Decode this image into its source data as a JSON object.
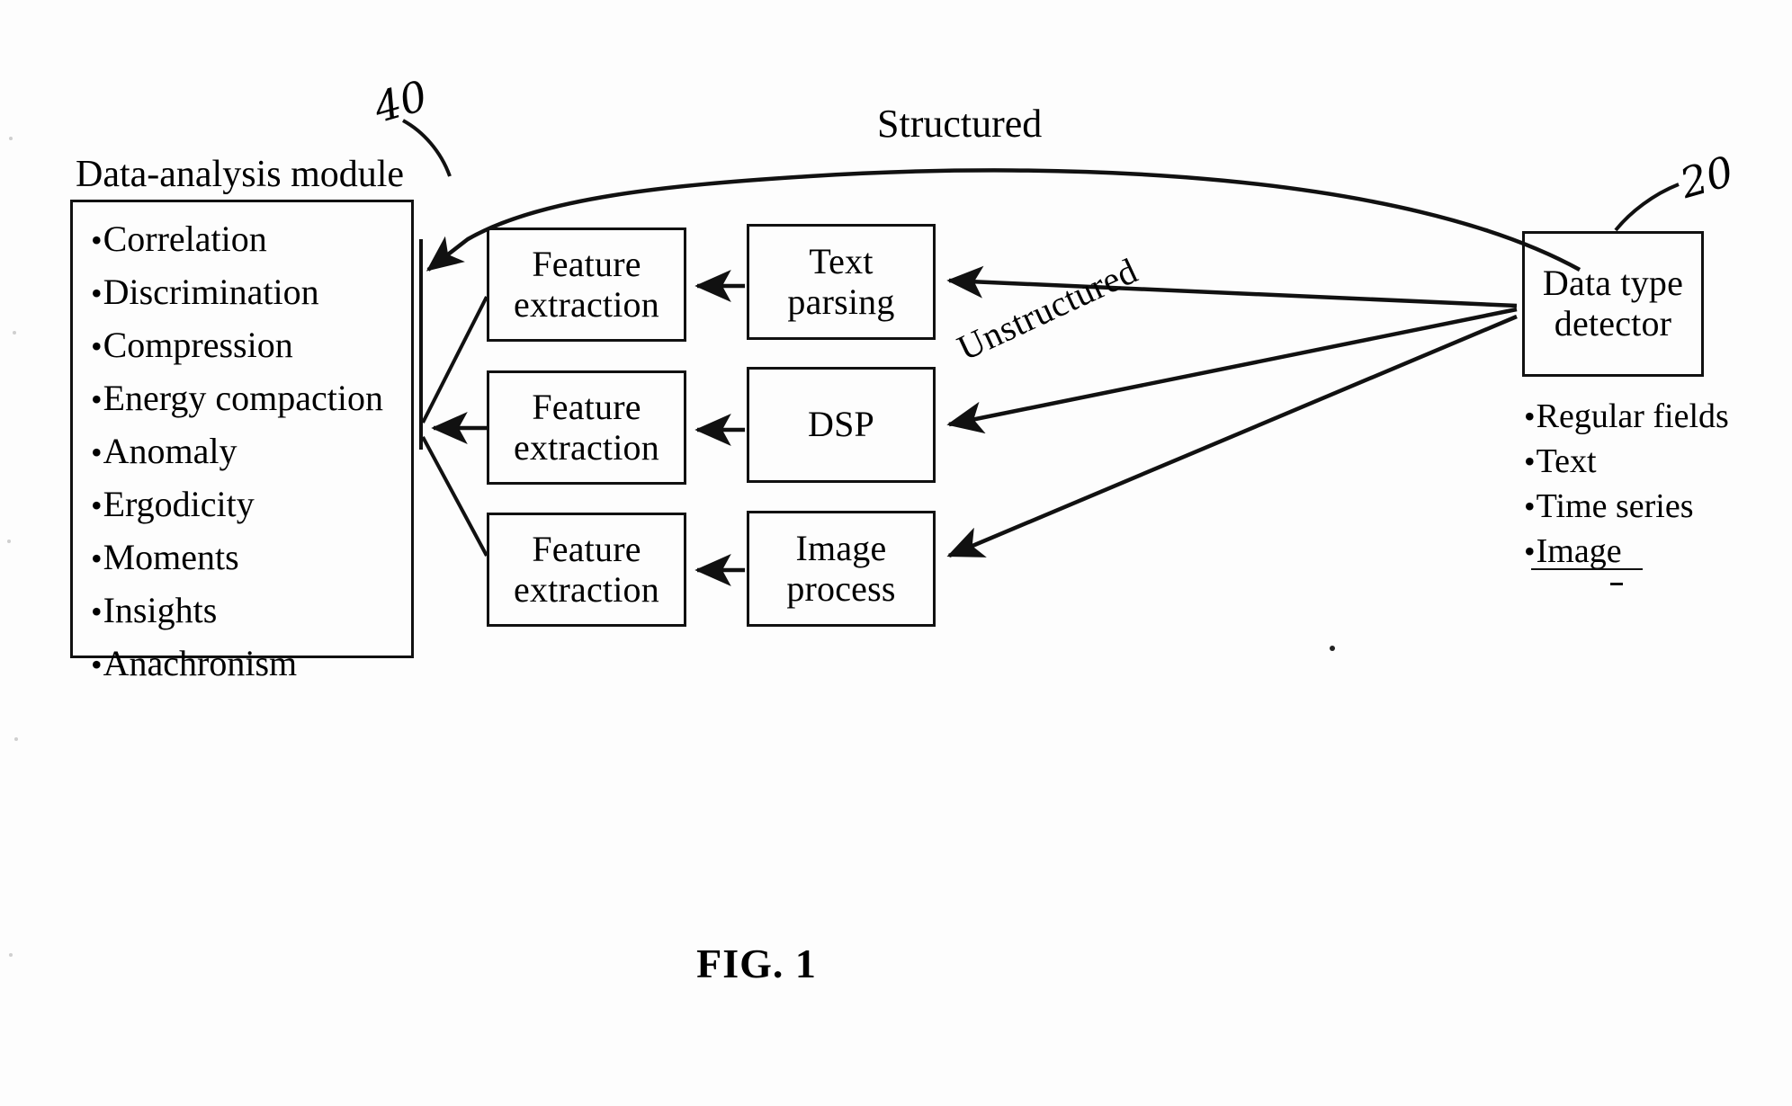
{
  "figure": {
    "caption": "FIG. 1",
    "reference_numerals": [
      {
        "id": "40",
        "target": "Data-analysis module"
      },
      {
        "id": "20",
        "target": "Data type detector"
      }
    ]
  },
  "data_analysis_module": {
    "title": "Data-analysis module",
    "ref": "40",
    "items": [
      "Correlation",
      "Discrimination",
      "Compression",
      "Energy compaction",
      "Anomaly",
      "Ergodicity",
      "Moments",
      "Insights",
      "Anachronism"
    ]
  },
  "pipelines": [
    {
      "feature_extraction": "Feature\nextraction",
      "fe_line1": "Feature",
      "fe_line2": "extraction",
      "processor_line1": "Text",
      "processor_line2": "parsing"
    },
    {
      "fe_line1": "Feature",
      "fe_line2": "extraction",
      "processor_line1": "DSP",
      "processor_line2": ""
    },
    {
      "fe_line1": "Feature",
      "fe_line2": "extraction",
      "processor_line1": "Image",
      "processor_line2": "process"
    }
  ],
  "data_type_detector": {
    "title_line1": "Data type",
    "title_line2": "detector",
    "ref": "20",
    "items": [
      "Regular fields",
      "Text",
      "Time series",
      "Image"
    ]
  },
  "edge_labels": {
    "structured": "Structured",
    "unstructured": "Unstructured"
  },
  "bullet": "•",
  "colors": {
    "ink": "#111111",
    "paper": "#fdfdfd"
  }
}
